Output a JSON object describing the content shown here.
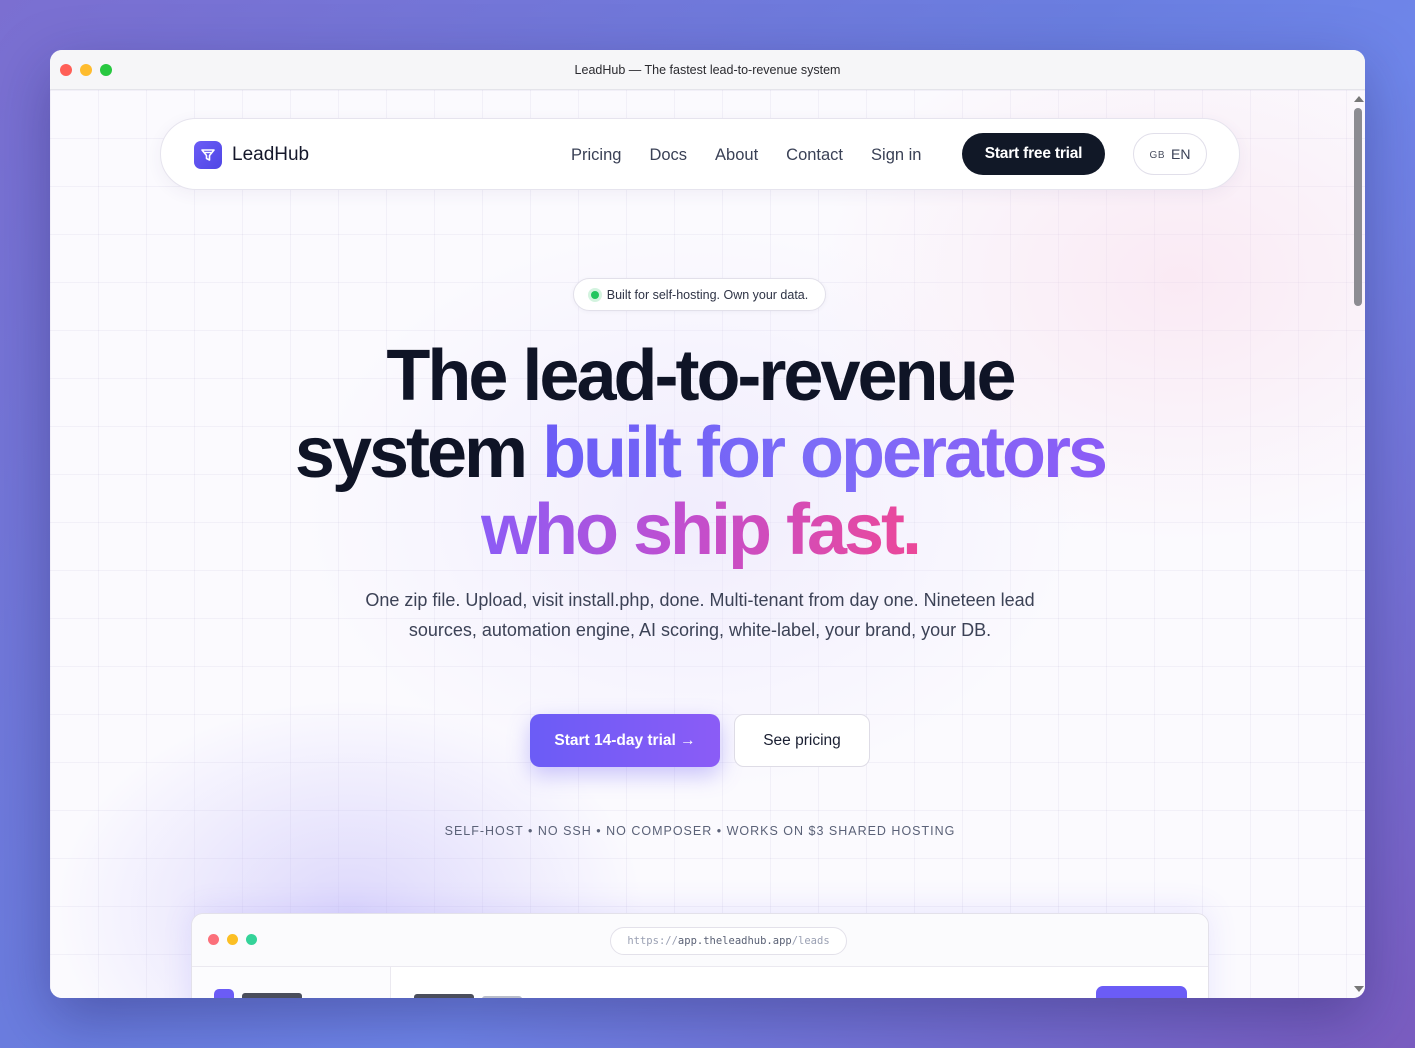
{
  "window": {
    "title": "LeadHub — The fastest lead-to-revenue system"
  },
  "nav": {
    "brand": "LeadHub",
    "links": [
      "Pricing",
      "Docs",
      "About",
      "Contact",
      "Sign in"
    ],
    "cta": "Start free trial",
    "lang_flag": "GB",
    "lang_code": "EN"
  },
  "hero": {
    "badge": "Built for self-hosting. Own your data.",
    "line1": "The lead-to-revenue",
    "line2_plain": "system ",
    "line2_accent": "built for operators",
    "line3_accent": "who ship fast.",
    "subtitle": "One zip file. Upload, visit install.php, done. Multi-tenant from day one. Nineteen lead sources, automation engine, AI scoring, white-label, your brand, your DB.",
    "primary_cta": "Start 14-day trial →",
    "secondary_cta": "See pricing",
    "tagline": "SELF-HOST • NO SSH • NO COMPOSER • WORKS ON $3 SHARED HOSTING"
  },
  "preview": {
    "url_scheme": "https://",
    "url_host": "app.theleadhub.app",
    "url_path": "/leads"
  },
  "colors": {
    "accent": "#6b5cf6",
    "accent_pink": "#ec4899",
    "dark": "#111827",
    "status_green": "#22c55e"
  }
}
